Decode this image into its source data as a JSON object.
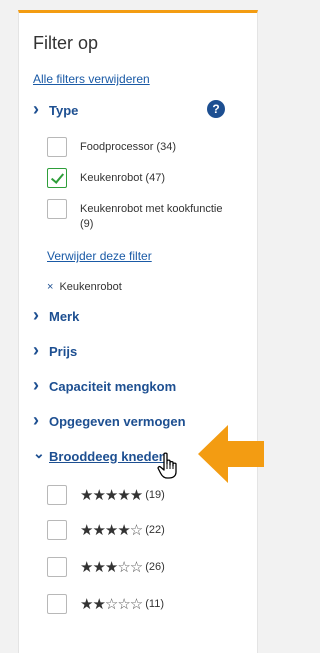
{
  "filter": {
    "title": "Filter op",
    "clear_all": "Alle filters verwijderen",
    "sections": {
      "type": "Type",
      "merk": "Merk",
      "prijs": "Prijs",
      "capaciteit": "Capaciteit mengkom",
      "vermogen": "Opgegeven vermogen",
      "brooddeeg": "Brooddeeg kneden"
    },
    "help_icon": "?",
    "type_options": [
      {
        "label": "Foodprocessor (34)",
        "checked": false
      },
      {
        "label": "Keukenrobot (47)",
        "checked": true
      },
      {
        "label": "Keukenrobot met kookfunctie (9)",
        "checked": false
      }
    ],
    "remove_filter": "Verwijder deze filter",
    "active_filter": {
      "remove_symbol": "×",
      "label": "Keukenrobot"
    },
    "rating_options": [
      {
        "filled": "★★★★★",
        "empty": "",
        "count": "(19)"
      },
      {
        "filled": "★★★★",
        "empty": "☆",
        "count": "(22)"
      },
      {
        "filled": "★★★",
        "empty": "☆☆",
        "count": "(26)"
      },
      {
        "filled": "★★",
        "empty": "☆☆☆",
        "count": "(11)"
      }
    ]
  },
  "colors": {
    "accent": "#f39c12",
    "heading_blue": "#1d4f91",
    "link_blue": "#1a5aa6",
    "check_green": "#2e9e3a"
  },
  "icons": [
    "chevron-right-icon",
    "chevron-down-icon",
    "help-icon",
    "checkmark-icon",
    "star-icon",
    "hand-cursor-icon",
    "orange-arrow-icon"
  ]
}
